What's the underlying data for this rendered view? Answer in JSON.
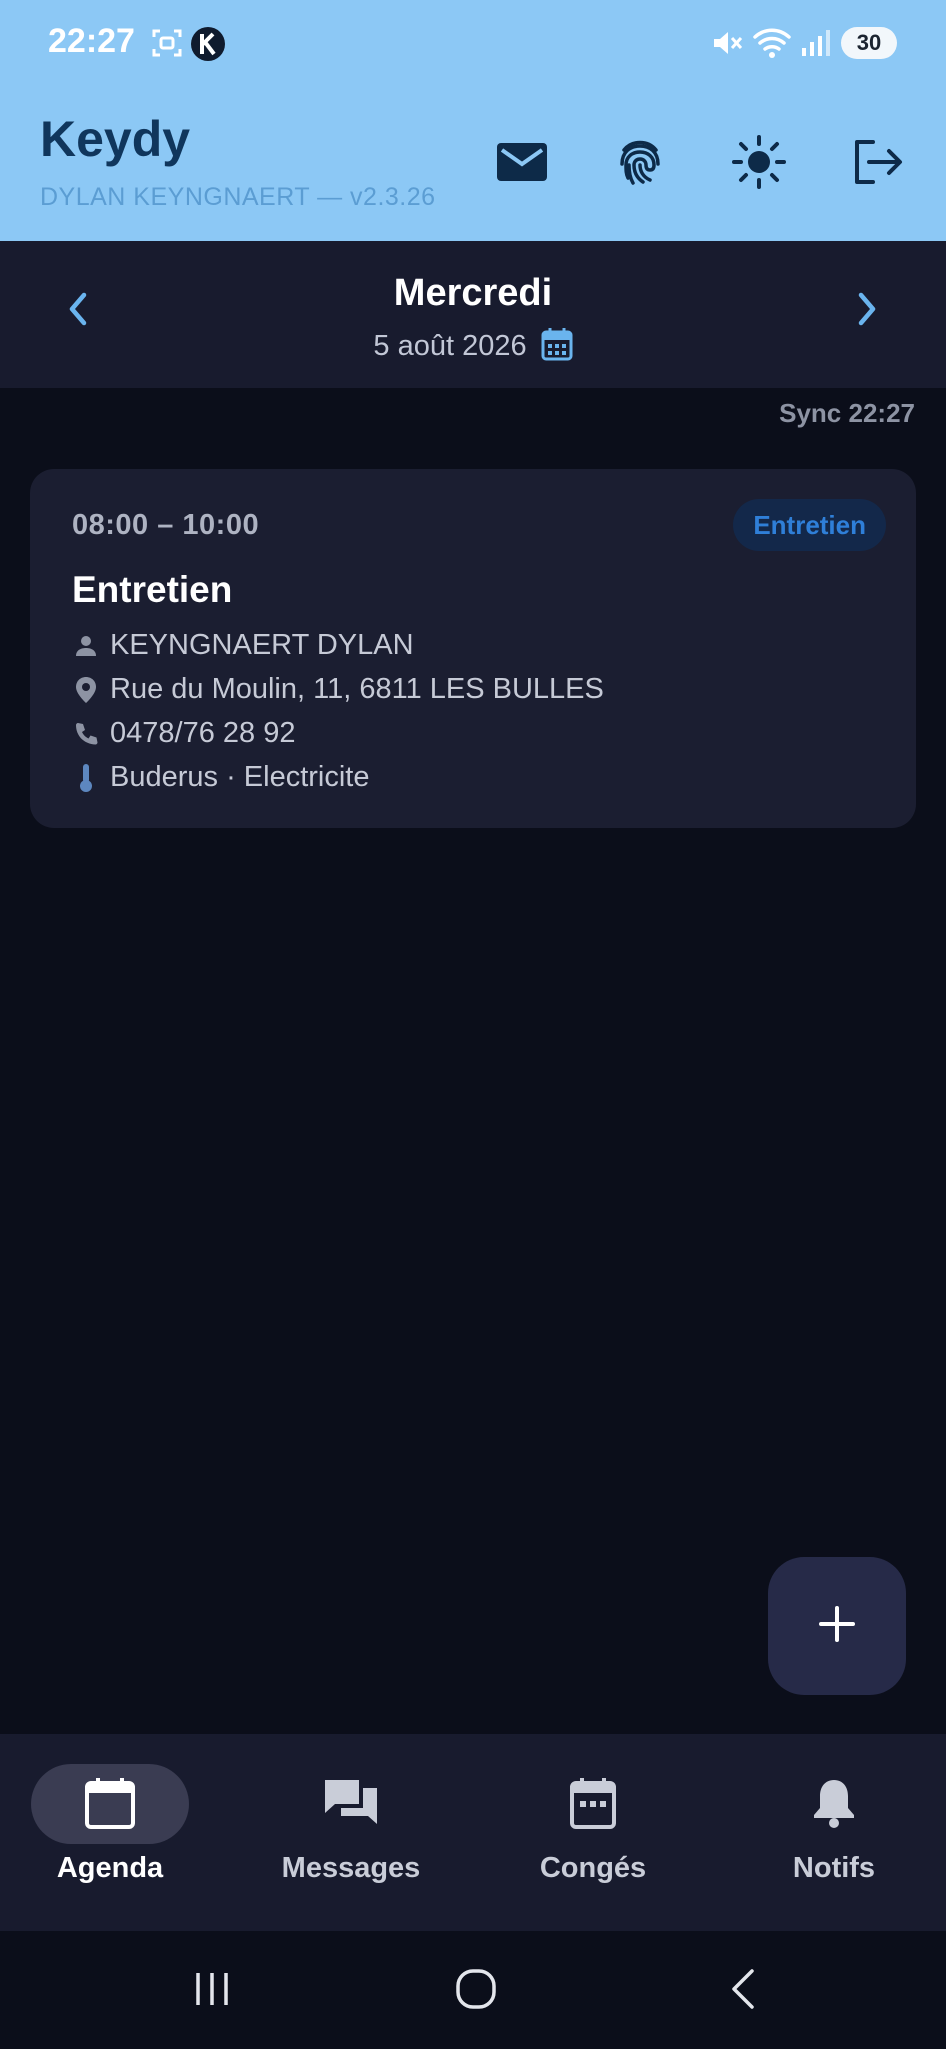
{
  "status_bar": {
    "time": "22:27",
    "battery": "30",
    "icons": [
      "screenshot-icon",
      "k-app-icon",
      "mute-icon",
      "wifi-icon",
      "signal-icon"
    ]
  },
  "header": {
    "title": "Keydy",
    "subtitle": "DYLAN KEYNGNAERT — v2.3.26",
    "actions": [
      "mail-icon",
      "fingerprint-icon",
      "brightness-icon",
      "logout-icon"
    ]
  },
  "date_nav": {
    "day_name": "Mercredi",
    "date": "5 août 2026"
  },
  "sync_label": "Sync 22:27",
  "appointment": {
    "time_range": "08:00 – 10:00",
    "badge": "Entretien",
    "title": "Entretien",
    "client": "KEYNGNAERT DYLAN",
    "address": "Rue du Moulin, 11, 6811 LES BULLES",
    "phone": "0478/76 28 92",
    "equipment": "Buderus · Electricite"
  },
  "fab": {
    "icon": "plus-icon"
  },
  "bottom_nav": {
    "tabs": [
      {
        "label": "Agenda",
        "icon": "calendar-icon",
        "active": true
      },
      {
        "label": "Messages",
        "icon": "chat-icon",
        "active": false
      },
      {
        "label": "Congés",
        "icon": "calendar-dots-icon",
        "active": false
      },
      {
        "label": "Notifs",
        "icon": "bell-icon",
        "active": false
      }
    ]
  },
  "colors": {
    "header_bg": "#8cc8f5",
    "page_bg": "#0b0e1a",
    "surface": "#181b2e",
    "card_bg": "#1b1e31",
    "accent": "#2f7fd8",
    "title_color": "#10365c"
  }
}
